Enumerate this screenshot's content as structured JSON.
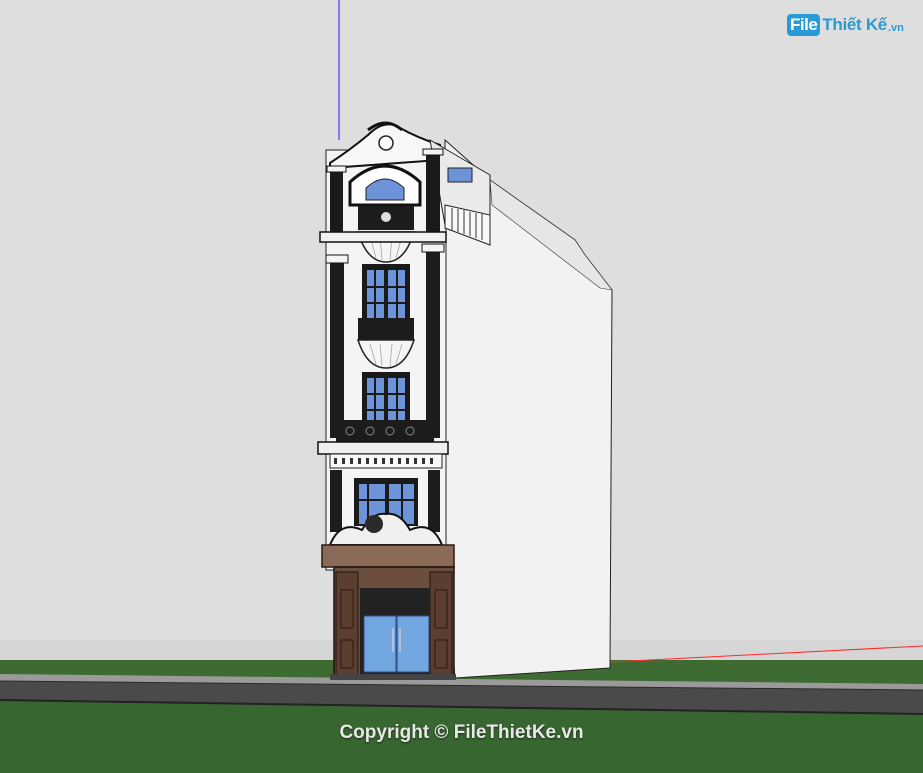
{
  "watermark": {
    "logo_file": "File",
    "logo_rest": "Thiết Kế",
    "logo_tld": ".vn"
  },
  "footer": {
    "copyright": "Copyright © FileThietKe.vn"
  },
  "colors": {
    "sky": "#dedede",
    "ground": "#3d6b32",
    "road": "#4a4a4a",
    "facade_dark": "#1c1c1c",
    "facade_white": "#f4f4f4",
    "glass": "#6d93d8",
    "stone": "#6b4e3d",
    "logo": "#2a9ad6",
    "axis_blue": "#3b3bff",
    "axis_red": "#ff2a2a"
  }
}
